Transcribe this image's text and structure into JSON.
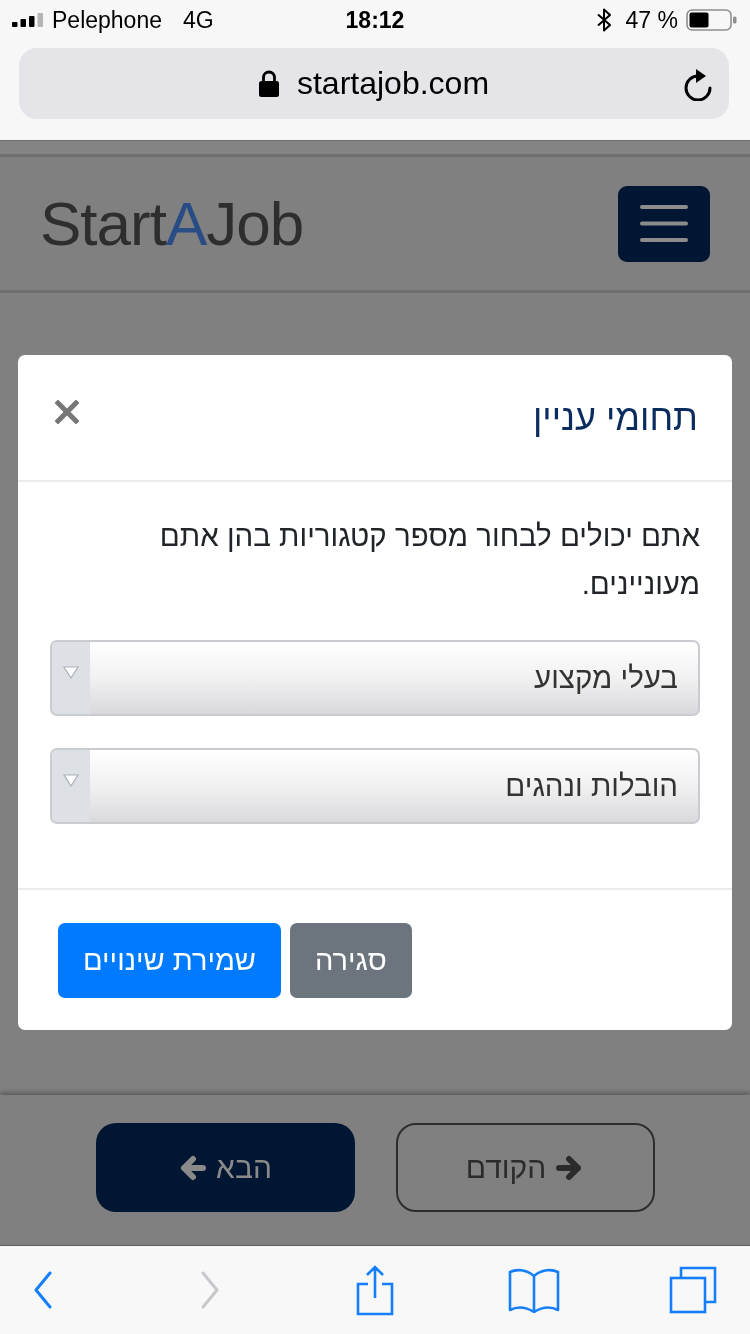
{
  "status_bar": {
    "carrier": "Pelephone",
    "network": "4G",
    "time": "18:12",
    "battery": "47 %"
  },
  "address_bar": {
    "url": "startajob.com"
  },
  "site_header": {
    "logo": {
      "lead": "Start",
      "highlight": "A",
      "tail": "Job"
    }
  },
  "modal": {
    "title": "תחומי עניין",
    "text": "אתם יכולים לבחור מספר קטגוריות בהן אתם מעוניינים.",
    "selects": [
      {
        "value": "בעלי מקצוע"
      },
      {
        "value": "הובלות ונהגים"
      }
    ],
    "buttons": [
      {
        "label": "סגירה",
        "kind": "secondary"
      },
      {
        "label": "שמירת שינויים",
        "kind": "primary"
      }
    ]
  },
  "wizard_nav": {
    "buttons": [
      {
        "label": "הקודם",
        "kind": "previous"
      },
      {
        "label": "הבא",
        "kind": "next"
      }
    ]
  },
  "browser_toolbar": {
    "items": [
      {
        "kind": "back",
        "disabled": false
      },
      {
        "kind": "forward",
        "disabled": true
      },
      {
        "kind": "share",
        "disabled": false
      },
      {
        "kind": "bookmarks",
        "disabled": false
      },
      {
        "kind": "tabs",
        "disabled": false
      }
    ]
  }
}
